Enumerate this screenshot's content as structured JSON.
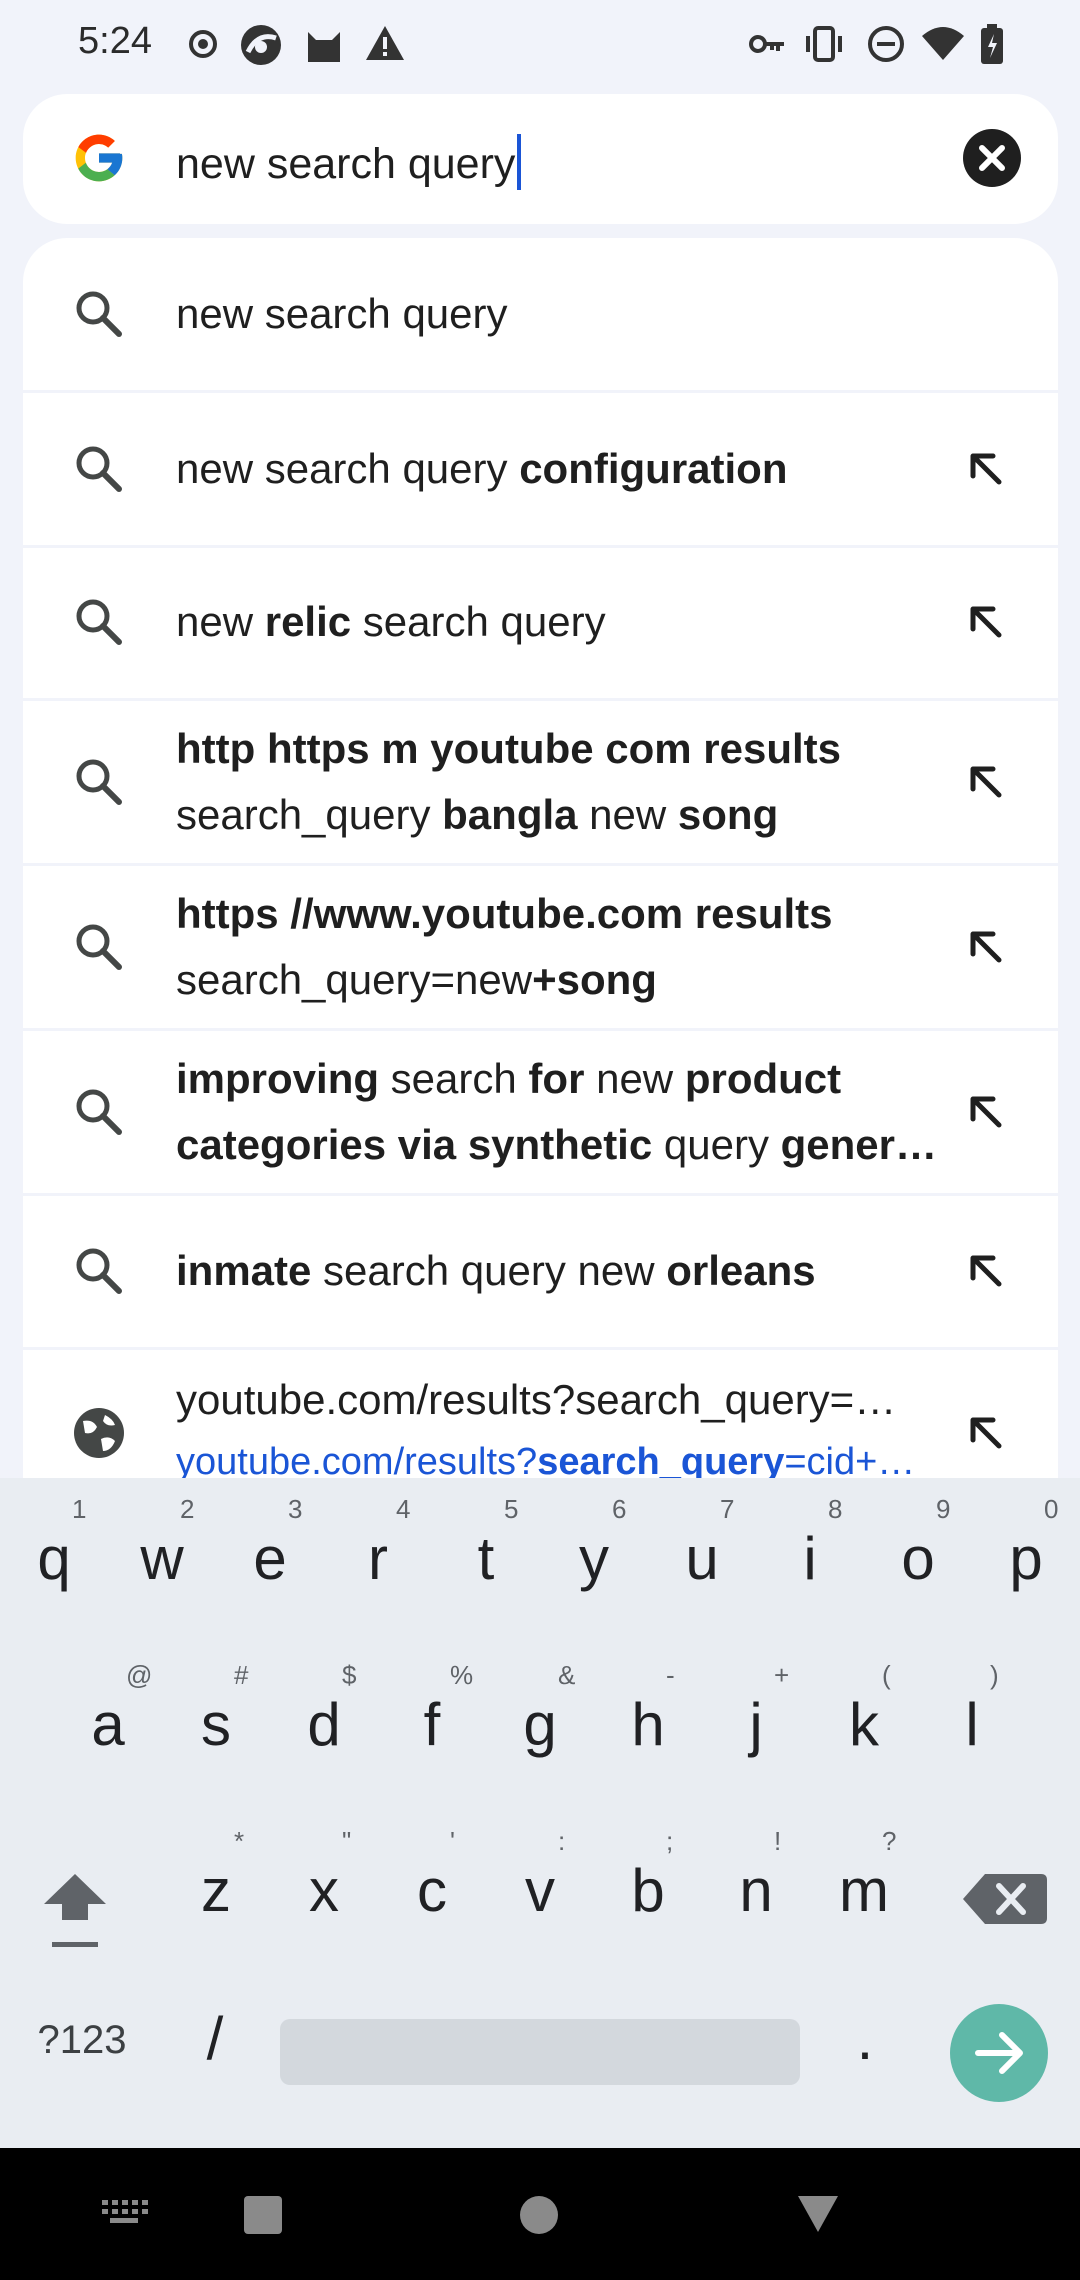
{
  "status_bar": {
    "time": "5:24",
    "left_icons": [
      "record-icon",
      "browser-icon",
      "cat-icon",
      "alert-icon"
    ],
    "right_icons": [
      "key-icon",
      "vibrate-icon",
      "dnd-icon",
      "wifi-icon",
      "battery-icon"
    ]
  },
  "search": {
    "query": "new search query",
    "clear_icon": "close-icon",
    "logo": "google-logo"
  },
  "suggestions": [
    {
      "type": "search",
      "line1": [
        {
          "t": "new search query",
          "b": false
        }
      ],
      "arrow": false
    },
    {
      "type": "search",
      "line1": [
        {
          "t": "new search query ",
          "b": false
        },
        {
          "t": "configuration",
          "b": true
        }
      ],
      "arrow": true
    },
    {
      "type": "search",
      "line1": [
        {
          "t": "new ",
          "b": false
        },
        {
          "t": "relic",
          "b": true
        },
        {
          "t": " search query",
          "b": false
        }
      ],
      "arrow": true
    },
    {
      "type": "search",
      "line1": [
        {
          "t": "http https m youtube com results",
          "b": true
        }
      ],
      "line2": [
        {
          "t": "search_query ",
          "b": false
        },
        {
          "t": "bangla",
          "b": true
        },
        {
          "t": " new ",
          "b": false
        },
        {
          "t": "song",
          "b": true
        }
      ],
      "arrow": true
    },
    {
      "type": "search",
      "line1": [
        {
          "t": "https //www.youtube.com results",
          "b": true
        }
      ],
      "line2": [
        {
          "t": "search_query=new",
          "b": false
        },
        {
          "t": "+song",
          "b": true
        }
      ],
      "arrow": true
    },
    {
      "type": "search",
      "line1": [
        {
          "t": "improving",
          "b": true
        },
        {
          "t": " search ",
          "b": false
        },
        {
          "t": "for",
          "b": true
        },
        {
          "t": " new ",
          "b": false
        },
        {
          "t": "product",
          "b": true
        }
      ],
      "line2": [
        {
          "t": "categories via synthetic",
          "b": true
        },
        {
          "t": " query ",
          "b": false
        },
        {
          "t": "gener…",
          "b": true
        }
      ],
      "arrow": true
    },
    {
      "type": "search",
      "line1": [
        {
          "t": "inmate",
          "b": true
        },
        {
          "t": " search query new ",
          "b": false
        },
        {
          "t": "orleans",
          "b": true
        }
      ],
      "arrow": true
    },
    {
      "type": "web",
      "line1": [
        {
          "t": "youtube.com/results?search_query=…",
          "b": false
        }
      ],
      "line2": [
        {
          "t": "youtube.com/results?",
          "b": false
        },
        {
          "t": "search_query",
          "b": true
        },
        {
          "t": "=cid+…",
          "b": false
        }
      ],
      "arrow": true
    }
  ],
  "keyboard": {
    "row1": [
      {
        "k": "q",
        "h": "1"
      },
      {
        "k": "w",
        "h": "2"
      },
      {
        "k": "e",
        "h": "3"
      },
      {
        "k": "r",
        "h": "4"
      },
      {
        "k": "t",
        "h": "5"
      },
      {
        "k": "y",
        "h": "6"
      },
      {
        "k": "u",
        "h": "7"
      },
      {
        "k": "i",
        "h": "8"
      },
      {
        "k": "o",
        "h": "9"
      },
      {
        "k": "p",
        "h": "0"
      }
    ],
    "row2": [
      {
        "k": "a",
        "h": "@"
      },
      {
        "k": "s",
        "h": "#"
      },
      {
        "k": "d",
        "h": "$"
      },
      {
        "k": "f",
        "h": "%"
      },
      {
        "k": "g",
        "h": "&"
      },
      {
        "k": "h",
        "h": "-"
      },
      {
        "k": "j",
        "h": "+"
      },
      {
        "k": "k",
        "h": "("
      },
      {
        "k": "l",
        "h": ")"
      }
    ],
    "row3": [
      {
        "k": "z",
        "h": "*"
      },
      {
        "k": "x",
        "h": "\""
      },
      {
        "k": "c",
        "h": "'"
      },
      {
        "k": "v",
        "h": ":"
      },
      {
        "k": "b",
        "h": ";"
      },
      {
        "k": "n",
        "h": "!"
      },
      {
        "k": "m",
        "h": "?"
      }
    ],
    "symbols_label": "?123",
    "slash_label": "/",
    "period_label": ".",
    "shift_icon": "shift-icon",
    "backspace_icon": "backspace-icon",
    "enter_icon": "go-arrow-icon"
  },
  "nav_bar": {
    "icons": [
      "keyboard-switch-icon",
      "recents-icon",
      "home-icon",
      "back-icon"
    ]
  }
}
